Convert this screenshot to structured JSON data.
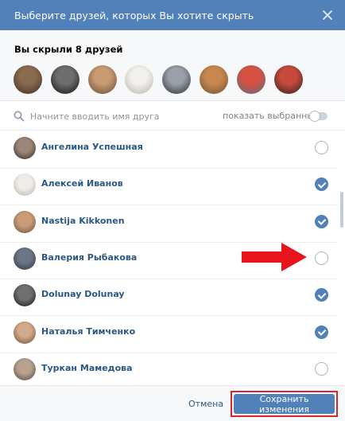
{
  "dialog": {
    "title": "Выберите друзей, которых Вы хотите скрыть"
  },
  "hidden_friends": {
    "title": "Вы скрыли 8 друзей",
    "avatars": [
      {
        "colors": [
          "#8b6b4e",
          "#3c2e24"
        ]
      },
      {
        "colors": [
          "#6e6e6e",
          "#111111"
        ]
      },
      {
        "colors": [
          "#c79a72",
          "#6b4a33"
        ]
      },
      {
        "colors": [
          "#f2f0ec",
          "#b9b2a8"
        ]
      },
      {
        "colors": [
          "#9aa0a8",
          "#2b2f35"
        ]
      },
      {
        "colors": [
          "#c8874e",
          "#6e5036"
        ]
      },
      {
        "colors": [
          "#d8503f",
          "#5c6d86"
        ]
      },
      {
        "colors": [
          "#c94a3c",
          "#2a2222"
        ]
      }
    ]
  },
  "search": {
    "placeholder": "Начните вводить имя друга",
    "show_selected_label": "показать выбранных"
  },
  "friends": [
    {
      "name": "Ангелина Успешная",
      "checked": false,
      "colors": [
        "#9b8778",
        "#2d2622"
      ]
    },
    {
      "name": "Алексей Иванов",
      "checked": true,
      "colors": [
        "#f0ede8",
        "#b8b0a5"
      ]
    },
    {
      "name": "Nastija Kikkonen",
      "checked": true,
      "colors": [
        "#c99b77",
        "#6d4e39"
      ]
    },
    {
      "name": "Валерия Рыбакова",
      "checked": false,
      "colors": [
        "#6a7585",
        "#2d3340"
      ]
    },
    {
      "name": "Dolunay Dolunay",
      "checked": true,
      "colors": [
        "#707070",
        "#121212"
      ]
    },
    {
      "name": "Наталья Тимченко",
      "checked": true,
      "colors": [
        "#d2a98a",
        "#6b4a36"
      ]
    },
    {
      "name": "Туркан Мамедова",
      "checked": false,
      "colors": [
        "#b7a18f",
        "#5a4637"
      ]
    }
  ],
  "footer": {
    "cancel_label": "Отмена",
    "save_label": "Сохранить изменения"
  },
  "colors": {
    "accent": "#5181b8",
    "highlight_red": "#d9262a"
  }
}
